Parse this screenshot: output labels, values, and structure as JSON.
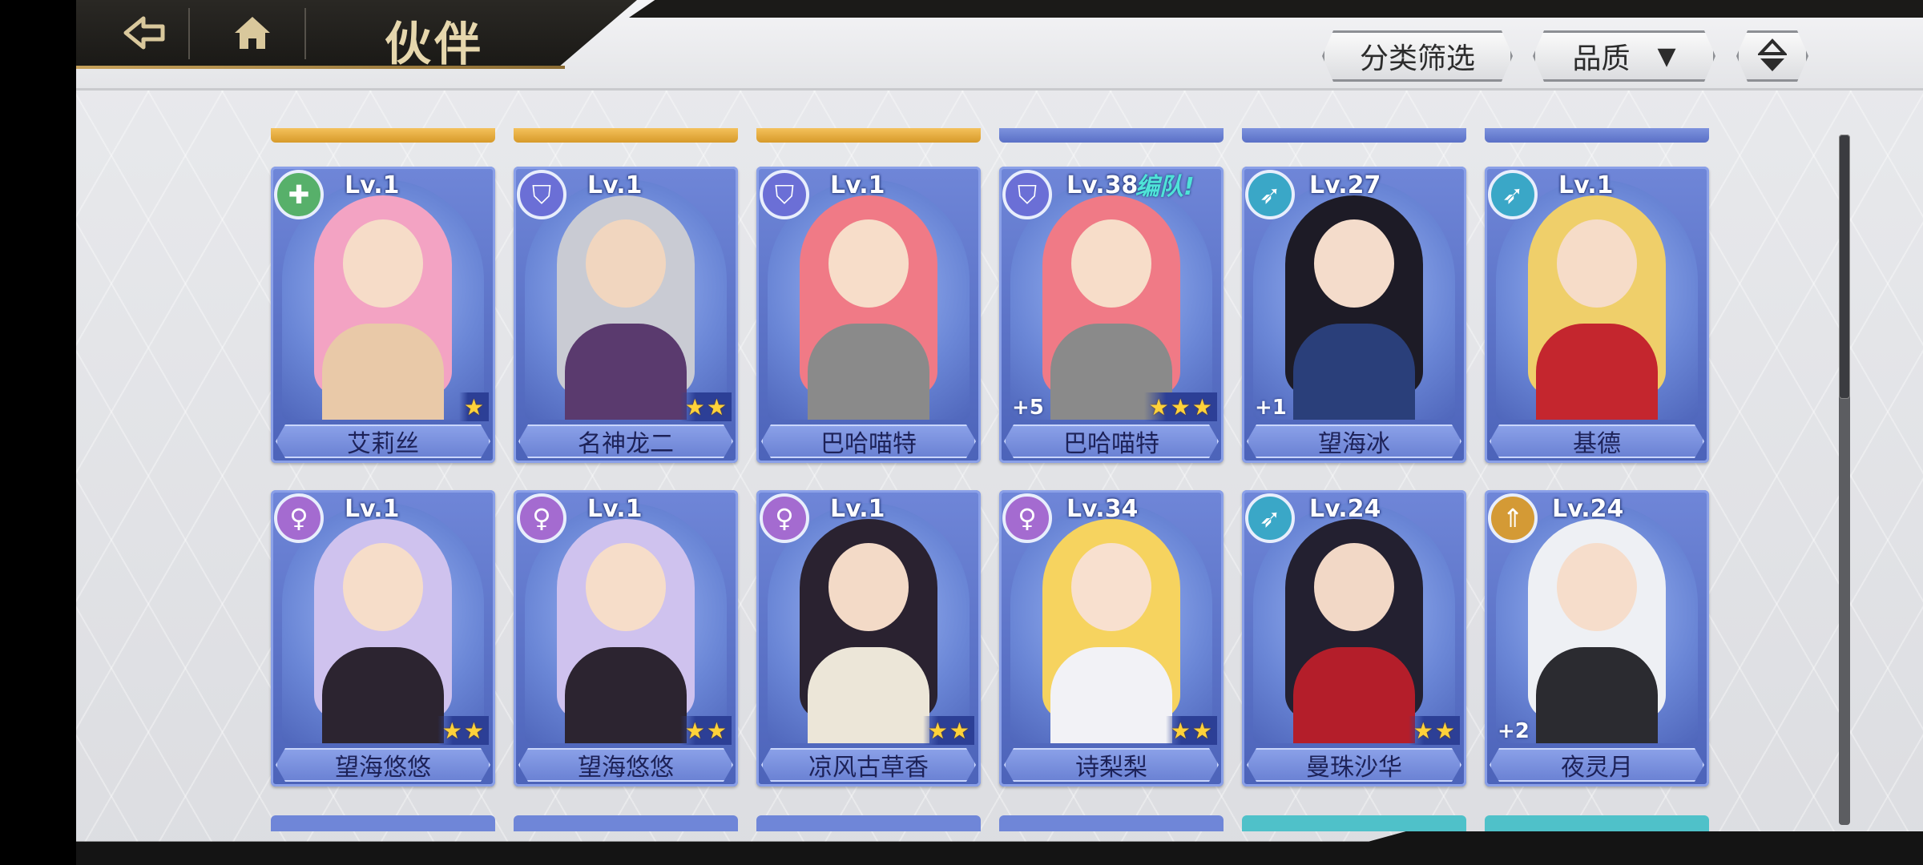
{
  "header": {
    "title": "伙伴",
    "filter_label": "分类筛选",
    "quality_label": "品质",
    "quality_arrow": "▼",
    "back_icon": "back-arrow-icon",
    "home_icon": "home-icon",
    "sort_icon": "sort-toggle-icon"
  },
  "colors": {
    "card_blue": "#5b72c8",
    "gold_title": "#e6d7ad",
    "star": "#ffd23a",
    "team_tag": "#4fe3d7"
  },
  "class_icons": {
    "support": "✚",
    "defender": "⛉",
    "archer": "➶",
    "mage": "♀",
    "warrior": "⇑"
  },
  "partners": [
    {
      "name": "艾莉丝",
      "level": "Lv.1",
      "stars": 1,
      "plus": "",
      "team": "",
      "class": "support",
      "hair": "#f3a3c3",
      "skin": "#f6dcc8",
      "body": "#e9c9a8"
    },
    {
      "name": "名神龙二",
      "level": "Lv.1",
      "stars": 2,
      "plus": "",
      "team": "",
      "class": "defender",
      "hair": "#c9cbd3",
      "skin": "#f1d6bf",
      "body": "#5a3a6e"
    },
    {
      "name": "巴哈喵特",
      "level": "Lv.1",
      "stars": 0,
      "plus": "",
      "team": "",
      "class": "defender",
      "hair": "#f07a86",
      "skin": "#f7ddc9",
      "body": "#8a8a8a"
    },
    {
      "name": "巴哈喵特",
      "level": "Lv.38",
      "stars": 3,
      "plus": "+5",
      "team": "编队!",
      "class": "defender",
      "hair": "#f07a86",
      "skin": "#f7ddc9",
      "body": "#8a8a8a"
    },
    {
      "name": "望海冰",
      "level": "Lv.27",
      "stars": 0,
      "plus": "+1",
      "team": "",
      "class": "archer",
      "hair": "#1d1b26",
      "skin": "#f4dccb",
      "body": "#2a3f7a"
    },
    {
      "name": "基德",
      "level": "Lv.1",
      "stars": 0,
      "plus": "",
      "team": "",
      "class": "archer",
      "hair": "#efcf6a",
      "skin": "#f6dcc8",
      "body": "#c4262e"
    },
    {
      "name": "望海悠悠",
      "level": "Lv.1",
      "stars": 2,
      "plus": "",
      "team": "",
      "class": "mage",
      "hair": "#cfc2ee",
      "skin": "#f6ddc9",
      "body": "#2c2430"
    },
    {
      "name": "望海悠悠",
      "level": "Lv.1",
      "stars": 2,
      "plus": "",
      "team": "",
      "class": "mage",
      "hair": "#cfc2ee",
      "skin": "#f6ddc9",
      "body": "#2c2430"
    },
    {
      "name": "凉风古草香",
      "level": "Lv.1",
      "stars": 2,
      "plus": "",
      "team": "",
      "class": "mage",
      "hair": "#2a2230",
      "skin": "#f3dac7",
      "body": "#ece6d8"
    },
    {
      "name": "诗梨梨",
      "level": "Lv.34",
      "stars": 2,
      "plus": "",
      "team": "",
      "class": "mage",
      "hair": "#f6d35f",
      "skin": "#f8e0cf",
      "body": "#f2f2f6"
    },
    {
      "name": "曼珠沙华",
      "level": "Lv.24",
      "stars": 2,
      "plus": "",
      "team": "",
      "class": "archer",
      "hair": "#232030",
      "skin": "#f2d8c6",
      "body": "#b41e2a"
    },
    {
      "name": "夜灵月",
      "level": "Lv.24",
      "stars": 0,
      "plus": "+2",
      "team": "",
      "class": "warrior",
      "hair": "#eef0f4",
      "skin": "#f6ddcb",
      "body": "#2b2b30"
    }
  ]
}
